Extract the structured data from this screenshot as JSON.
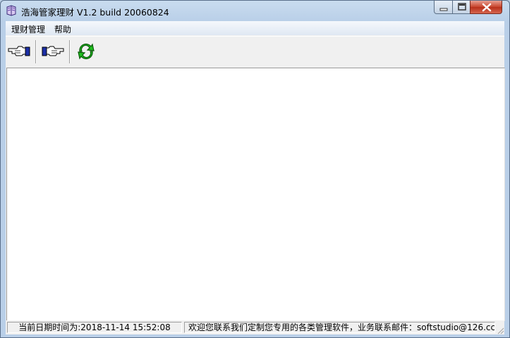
{
  "window": {
    "title": "浩海管家理财 V1.2 build 20060824",
    "icon": "app-book-icon"
  },
  "menu": {
    "items": [
      {
        "label": "理财管理"
      },
      {
        "label": "帮助"
      }
    ]
  },
  "toolbar": {
    "buttons": [
      {
        "icon": "hand-point-left-icon"
      },
      {
        "icon": "hand-point-right-icon"
      },
      {
        "icon": "refresh-icon"
      }
    ]
  },
  "status": {
    "datetime": "当前日期时间为:2018-11-14 15:52:08",
    "message": "欢迎您联系我们定制您专用的各类管理软件，业务联系邮件：softstudio@126.cc"
  },
  "colors": {
    "accent_green": "#1fbf1f",
    "close_red": "#c7432a"
  }
}
